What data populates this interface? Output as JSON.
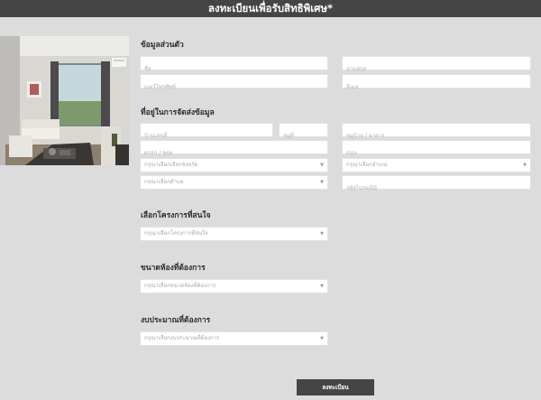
{
  "header": {
    "title": "ลงทะเบียนเพื่อรับสิทธิพิเศษ*"
  },
  "sections": {
    "personal": "ข้อมูลส่วนตัว",
    "address": "ที่อยู่ในการจัดส่งข้อมูล",
    "project": "เลือกโครงการที่สนใจ",
    "room": "ขนาดห้องที่ต้องการ",
    "budget": "งบประมาณที่ต้องการ"
  },
  "fields": {
    "first_name": "ชื่อ",
    "last_name": "นามสกุล",
    "phone": "เบอร์โทรศัพท์",
    "email": "อีเมล",
    "house_no": "บ้านเลขที่",
    "moo": "หมู่ที่",
    "village": "หมู่บ้าน / อาคาร",
    "soi": "ตรอก / ซอย",
    "road": "ถนน",
    "province": "กรุณาเลือกเลือกจังหวัด",
    "district": "กรุณาเลือกอำเภอ",
    "subdistrict": "กรุณาเลือกตำบล",
    "postcode": "รหัสไปรษณีย์",
    "project": "กรุณาเลือกโครงการที่สนใจ",
    "room": "กรุณาเลือกขนาดห้องที่ต้องการ",
    "budget": "กรุณาเลือกงบประมาณที่ต้องการ"
  },
  "submit_label": "ลงทะเบียน",
  "caret_glyph": "▼"
}
